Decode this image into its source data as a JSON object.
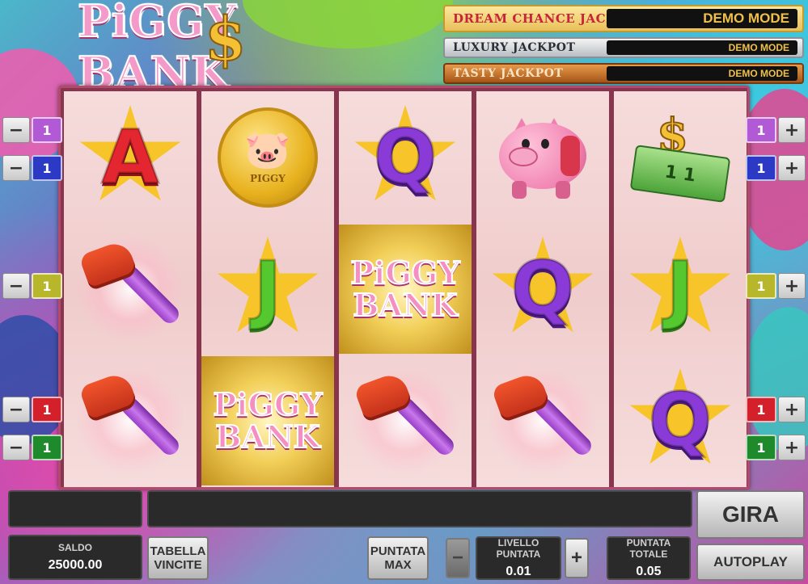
{
  "logo": {
    "text": "PiGGY BANK",
    "dollar": "$"
  },
  "jackpots": [
    {
      "name": "DREAM CHANCE JACKPOT",
      "value": "DEMO MODE"
    },
    {
      "name": "LUXURY JACKPOT",
      "value": "DEMO MODE"
    },
    {
      "name": "TASTY JACKPOT",
      "value": "DEMO MODE"
    }
  ],
  "reels": [
    {
      "symbols": [
        "A",
        "hammer",
        "hammer"
      ]
    },
    {
      "symbols": [
        "coin",
        "J",
        "piggy-bank-logo"
      ]
    },
    {
      "symbols": [
        "Q",
        "piggy-bank-logo",
        "hammer"
      ]
    },
    {
      "symbols": [
        "pig",
        "Q",
        "hammer"
      ]
    },
    {
      "symbols": [
        "cash",
        "J",
        "Q"
      ]
    }
  ],
  "symbols": {
    "coin_label": "PIGGY",
    "cash_text": "1 1",
    "piggy_line1": "PiGGY",
    "piggy_line2": "BANK",
    "letter_a": "A",
    "letter_j": "J",
    "letter_q": "Q"
  },
  "lines_left": [
    {
      "value": "1",
      "color": "#b25ad6",
      "minus": "−"
    },
    {
      "value": "1",
      "color": "#2b39c4",
      "minus": "−"
    },
    {
      "value": "1",
      "color": "#b8b62a",
      "minus": "−"
    },
    {
      "value": "1",
      "color": "#d4202a",
      "minus": "−"
    },
    {
      "value": "1",
      "color": "#1f8a2c",
      "minus": "−"
    }
  ],
  "lines_right": [
    {
      "value": "1",
      "color": "#b25ad6",
      "plus": "+"
    },
    {
      "value": "1",
      "color": "#2b39c4",
      "plus": "+"
    },
    {
      "value": "1",
      "color": "#b8b62a",
      "plus": "+"
    },
    {
      "value": "1",
      "color": "#d4202a",
      "plus": "+"
    },
    {
      "value": "1",
      "color": "#1f8a2c",
      "plus": "+"
    }
  ],
  "bottom": {
    "saldo_label": "SALDO",
    "saldo_value": "25000.00",
    "tabella_line1": "TABELLA",
    "tabella_line2": "VINCITE",
    "puntata_max_line1": "PUNTATA",
    "puntata_max_line2": "MAX",
    "minus": "−",
    "plus": "+",
    "livello_label": "LIVELLO PUNTATA",
    "livello_value": "0.01",
    "totale_label": "PUNTATA TOTALE",
    "totale_value": "0.05",
    "gira": "GIRA",
    "autoplay": "AUTOPLAY",
    "message": ""
  }
}
